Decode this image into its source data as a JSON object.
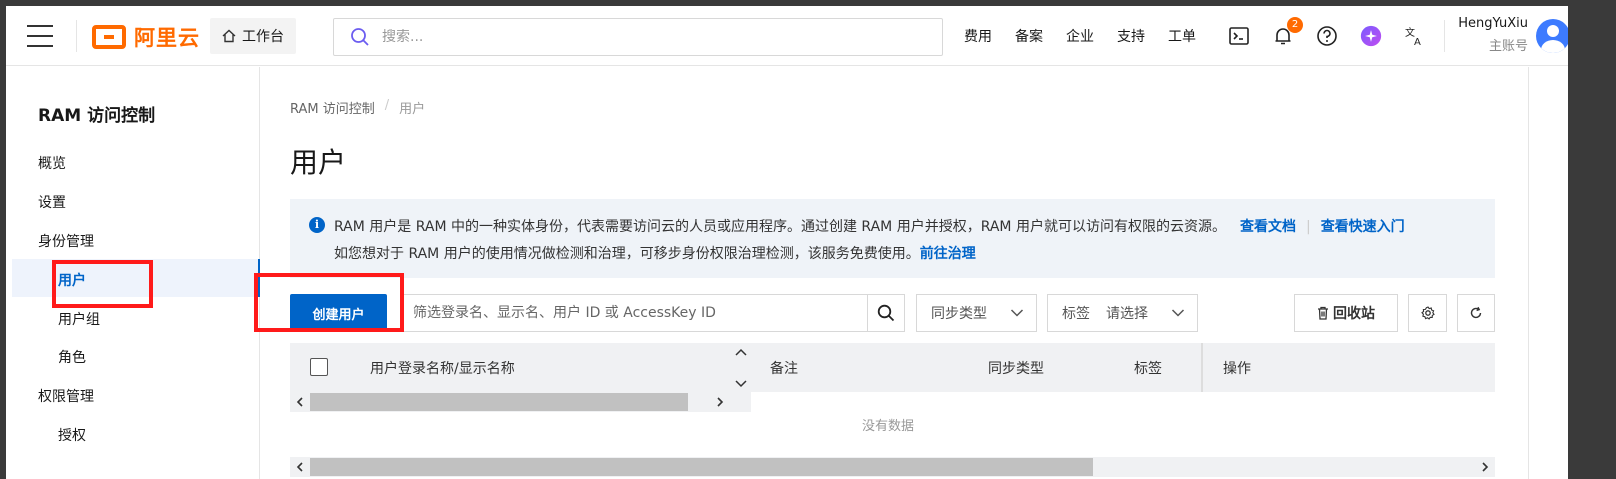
{
  "header": {
    "logo_text": "阿里云",
    "workbench_label": "工作台",
    "search_placeholder": "搜索...",
    "nav": [
      "费用",
      "备案",
      "企业",
      "支持",
      "工单"
    ],
    "notification_count": "2",
    "user_name": "HengYuXiu",
    "user_role": "主账号"
  },
  "sidebar": {
    "title": "RAM 访问控制",
    "items": [
      {
        "label": "概览"
      },
      {
        "label": "设置"
      },
      {
        "label": "身份管理"
      },
      {
        "label": "用户"
      },
      {
        "label": "用户组"
      },
      {
        "label": "角色"
      },
      {
        "label": "权限管理"
      },
      {
        "label": "授权"
      }
    ]
  },
  "main": {
    "breadcrumb": [
      "RAM 访问控制",
      "/",
      "用户"
    ],
    "title": "用户",
    "info": {
      "line1": "RAM 用户是 RAM 中的一种实体身份，代表需要访问云的人员或应用程序。通过创建 RAM 用户并授权，RAM 用户就可以访问有权限的云资源。",
      "link_docs": "查看文档",
      "link_quick": "查看快速入门",
      "line2": "如您想对于 RAM 用户的使用情况做检测和治理，可移步身份权限治理检测，该服务免费使用。",
      "link_govern": "前往治理"
    },
    "toolbar": {
      "create_label": "创建用户",
      "filter_placeholder": "筛选登录名、显示名、用户 ID 或 AccessKey ID",
      "sync_type_label": "同步类型",
      "tag_label": "标签",
      "tag_placeholder": "请选择",
      "recycle_label": "回收站"
    },
    "table": {
      "columns": [
        "用户登录名称/显示名称",
        "备注",
        "同步类型",
        "标签",
        "操作"
      ],
      "empty_text": "没有数据"
    }
  },
  "colors": {
    "brand": "#ff6a00",
    "primary": "#0064c8",
    "highlight": "#ff1a1a"
  }
}
